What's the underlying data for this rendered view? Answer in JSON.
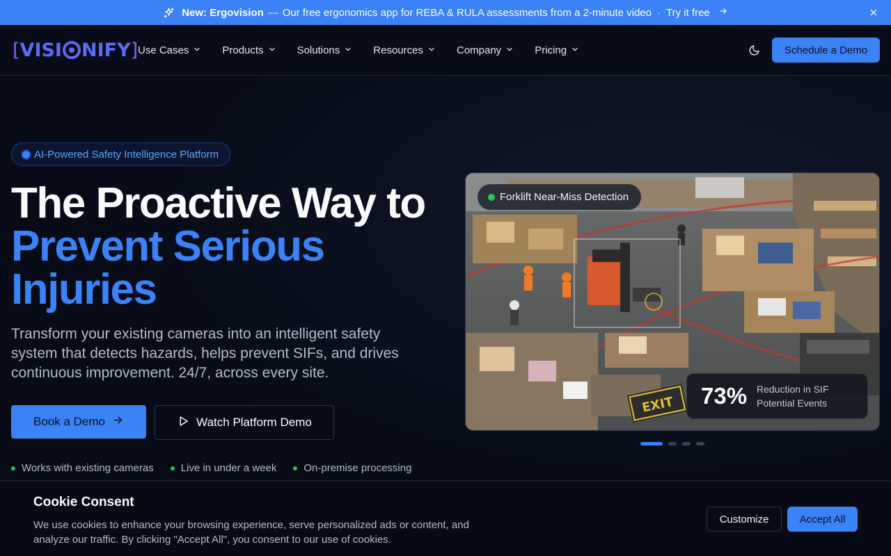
{
  "announcement": {
    "badge": "New: Ergovision",
    "separator": "—",
    "message": "Our free ergonomics app for REBA & RULA assessments from a 2-minute video",
    "dot": "·",
    "cta": "Try it free"
  },
  "nav": {
    "logo": {
      "left_bracket": "[",
      "part1": "VISI",
      "part2": "NIFY",
      "right_bracket": "]"
    },
    "menu": [
      {
        "label": "Use Cases"
      },
      {
        "label": "Products"
      },
      {
        "label": "Solutions"
      },
      {
        "label": "Resources"
      },
      {
        "label": "Company"
      },
      {
        "label": "Pricing"
      }
    ],
    "schedule_label": "Schedule a Demo"
  },
  "hero": {
    "pill": "AI-Powered Safety Intelligence Platform",
    "title_line1": "The Proactive Way to",
    "title_accent": "Prevent Serious Injuries",
    "subtitle": "Transform your existing cameras into an intelligent safety system that detects hazards, helps prevent SIFs, and drives continuous improvement. 24/7, across every site.",
    "book_label": "Book a Demo",
    "watch_label": "Watch Platform Demo",
    "features": [
      "Works with existing cameras",
      "Live in under a week",
      "On-premise processing"
    ]
  },
  "camera": {
    "tag": "Forklift Near-Miss Detection",
    "stat_value": "73%",
    "stat_label": "Reduction in SIF Potential Events",
    "floor_sign": "EXIT",
    "slides": 4,
    "active_slide": 0
  },
  "cookie": {
    "title": "Cookie Consent",
    "description": "We use cookies to enhance your browsing experience, serve personalized ads or content, and analyze our traffic. By clicking \"Accept All\", you consent to our use of cookies.",
    "customize_label": "Customize",
    "accept_label": "Accept All"
  },
  "colors": {
    "accent": "#3b82f6",
    "background": "#070b17",
    "success": "#22c55e",
    "logo": "#6366f1"
  },
  "icons": [
    "sparkle-icon",
    "arrow-right-icon",
    "close-icon",
    "chevron-down-icon",
    "moon-icon",
    "play-icon"
  ]
}
